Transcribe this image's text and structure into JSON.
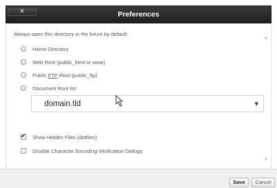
{
  "dialog": {
    "title": "Preferences",
    "close_glyph": "✕"
  },
  "default_dir": {
    "intro": "Always open this directory in the future by default:",
    "options": [
      {
        "label": "Home Directory",
        "selected": false
      },
      {
        "label": "Web Root (public_html or www)",
        "selected": false
      },
      {
        "label_prefix": "Public ",
        "label_underlined": "FTP",
        "label_suffix": " Root (public_ftp)",
        "selected": false
      },
      {
        "label": "Document Root for:",
        "selected": false
      }
    ],
    "domain_select": {
      "value": "domain.tld",
      "caret": "▼"
    }
  },
  "checkboxes": [
    {
      "label": "Show Hidden Files (dotfiles)",
      "checked": true,
      "tick": "✔"
    },
    {
      "label": "Disable Character Encoding Verification Dialogs",
      "checked": false
    }
  ],
  "scrollbar": {
    "up": "▲",
    "down": "▼"
  },
  "footer": {
    "save_label": "Save",
    "cancel_label": "Cancel"
  },
  "icons": {
    "close": "close-icon",
    "radio": "radio-icon",
    "checkbox": "checkbox-icon",
    "dropdown": "chevron-down-icon",
    "cursor": "mouse-pointer-icon"
  }
}
